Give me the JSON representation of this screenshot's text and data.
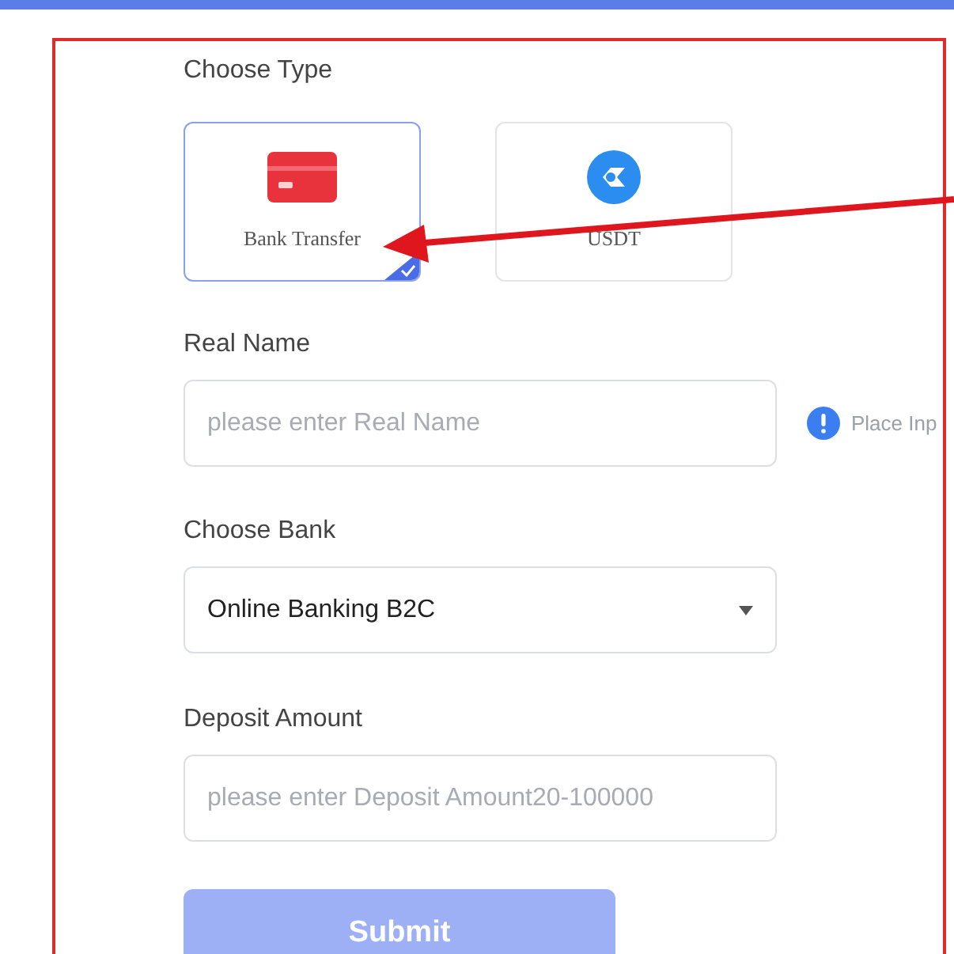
{
  "choose_type": {
    "label": "Choose Type",
    "options": [
      {
        "kind": "card",
        "label": "Bank Transfer",
        "selected": true
      },
      {
        "kind": "coin",
        "label": "USDT",
        "selected": false
      }
    ]
  },
  "real_name": {
    "label": "Real Name",
    "placeholder": "please enter Real Name",
    "hint": "Place Inp"
  },
  "choose_bank": {
    "label": "Choose Bank",
    "value": "Online Banking B2C"
  },
  "deposit_amount": {
    "label": "Deposit Amount",
    "placeholder": "please enter Deposit Amount20-100000"
  },
  "submit": {
    "label": "Submit",
    "disabled": true
  }
}
